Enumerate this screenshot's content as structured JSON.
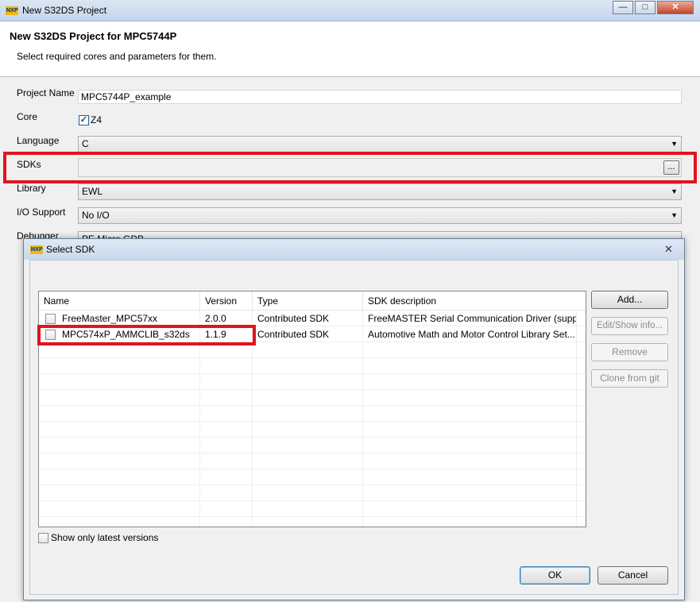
{
  "window": {
    "title": "New S32DS Project",
    "logo_text": "NXP",
    "controls": {
      "minimize": "—",
      "maximize": "□",
      "close": "✕"
    }
  },
  "banner": {
    "heading": "New S32DS Project for MPC5744P",
    "subtitle": "Select required cores and parameters for them."
  },
  "form": {
    "project_name_label": "Project Name",
    "project_name_value": "MPC5744P_example",
    "core_label": "Core",
    "core_option": "Z4",
    "language_label": "Language",
    "language_value": "C",
    "sdks_label": "SDKs",
    "sdks_value": "",
    "sdks_browse": "...",
    "library_label": "Library",
    "library_value": "EWL",
    "io_label": "I/O Support",
    "io_value": "No I/O",
    "debugger_label": "Debugger",
    "debugger_value": "PE Micro GDB"
  },
  "dialog": {
    "title": "Select SDK",
    "columns": [
      "Name",
      "Version",
      "Type",
      "SDK description"
    ],
    "rows": [
      {
        "name": "FreeMaster_MPC57xx",
        "version": "2.0.0",
        "type": "Contributed SDK",
        "description": "FreeMASTER Serial Communication Driver (supp..."
      },
      {
        "name": "MPC574xP_AMMCLIB_s32ds",
        "version": "1.1.9",
        "type": "Contributed SDK",
        "description": "Automotive Math and Motor Control Library Set..."
      }
    ],
    "buttons": {
      "add": "Add...",
      "edit": "Edit/Show info...",
      "remove": "Remove",
      "clone": "Clone from git"
    },
    "latest_only_label": "Show only latest versions",
    "ok": "OK",
    "cancel": "Cancel",
    "close": "✕"
  },
  "colors": {
    "highlight": "#e2141c",
    "title_bar": "#c8d8ec"
  }
}
